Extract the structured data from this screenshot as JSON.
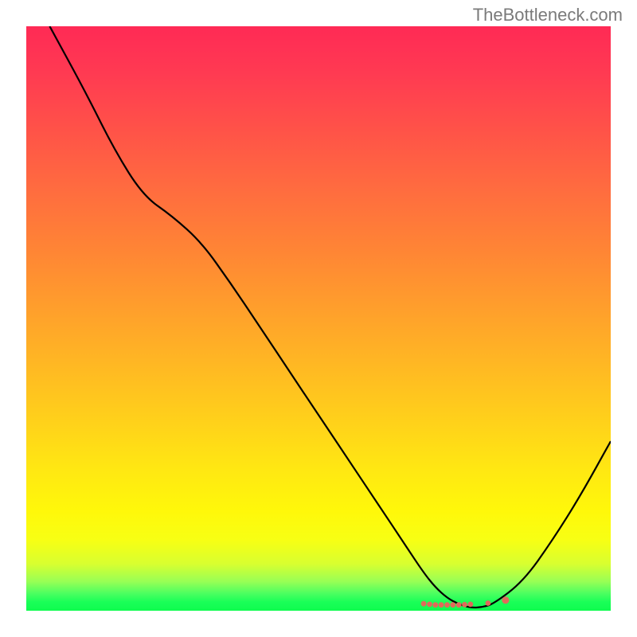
{
  "watermark": "TheBottleneck.com",
  "chart_data": {
    "type": "line",
    "title": "",
    "xlabel": "",
    "ylabel": "",
    "x_range": [
      0,
      100
    ],
    "y_range": [
      0,
      100
    ],
    "series": [
      {
        "name": "curve",
        "x": [
          4,
          10,
          15,
          20,
          25,
          30,
          35,
          40,
          45,
          50,
          55,
          60,
          65,
          68,
          70,
          72,
          74,
          76,
          78,
          80,
          85,
          90,
          95,
          100
        ],
        "y": [
          100,
          89,
          79,
          71,
          67.5,
          63,
          56,
          48.5,
          41,
          33.5,
          26,
          18.5,
          11,
          6.5,
          4,
          2.2,
          1.1,
          0.5,
          0.6,
          1.2,
          5,
          12,
          20,
          29
        ]
      }
    ],
    "markers": [
      {
        "x": 68,
        "y": 1.2
      },
      {
        "x": 69,
        "y": 1.1
      },
      {
        "x": 70,
        "y": 1.0
      },
      {
        "x": 71,
        "y": 1.0
      },
      {
        "x": 72,
        "y": 1.0
      },
      {
        "x": 73,
        "y": 1.0
      },
      {
        "x": 74,
        "y": 1.0
      },
      {
        "x": 75,
        "y": 1.05
      },
      {
        "x": 76,
        "y": 1.1
      },
      {
        "x": 79,
        "y": 1.3
      },
      {
        "x": 82,
        "y": 1.8
      }
    ],
    "gradient_stops": [
      {
        "pos": 0.0,
        "color": "#ff2a55"
      },
      {
        "pos": 0.5,
        "color": "#ffa82a"
      },
      {
        "pos": 0.85,
        "color": "#fff80a"
      },
      {
        "pos": 1.0,
        "color": "#0efc4e"
      }
    ]
  }
}
